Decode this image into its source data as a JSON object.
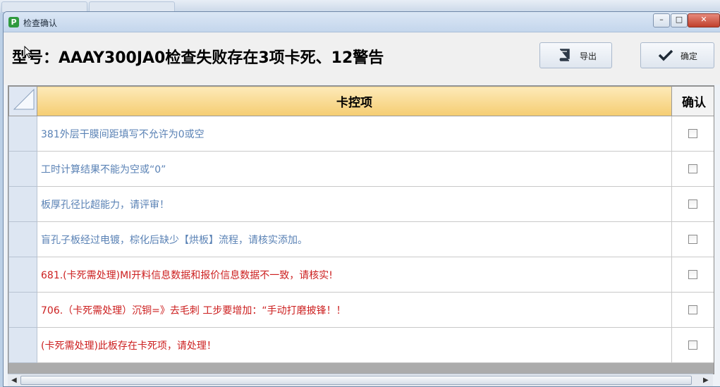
{
  "window": {
    "title": "检查确认"
  },
  "header": {
    "headline": "型号：AAAY300JA0检查失败存在3项卡死、12警告",
    "export_label": "导出",
    "confirm_label": "确定"
  },
  "grid": {
    "columns": [
      "卡控项",
      "确认"
    ],
    "rows": [
      {
        "text": "381外层干膜间距填写不允许为0或空",
        "severity": "warning",
        "checked": false
      },
      {
        "text": "工时计算结果不能为空或“0”",
        "severity": "warning",
        "checked": false
      },
      {
        "text": "板厚孔径比超能力，请评审！",
        "severity": "warning",
        "checked": false
      },
      {
        "text": "盲孔子板经过电镀，棕化后缺少【烘板】流程，请核实添加。",
        "severity": "warning",
        "checked": false
      },
      {
        "text": "681.(卡死需处理)MI开料信息数据和报价信息数据不一致，请核实!",
        "severity": "block",
        "checked": false
      },
      {
        "text": "706.（卡死需处理）沉铜=》去毛刺 工步要增加：“手动打磨披锋！！",
        "severity": "block",
        "checked": false
      },
      {
        "text": "(卡死需处理)此板存在卡死项，请处理！",
        "severity": "block",
        "checked": false
      }
    ]
  },
  "colors": {
    "warning_text": "#5a82b5",
    "block_text": "#cc1f1f",
    "header_bg": "#f5cd72"
  },
  "icons": {
    "export": "book-icon",
    "confirm": "checkmark-icon",
    "app": "app-p-icon"
  }
}
